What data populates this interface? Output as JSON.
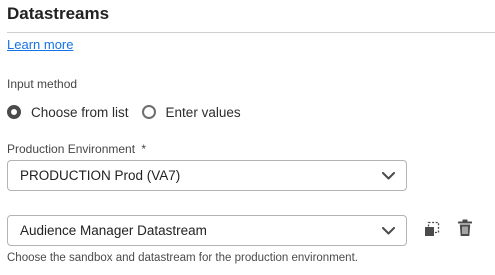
{
  "section": {
    "title": "Datastreams",
    "learn_more": "Learn more"
  },
  "input_method": {
    "label": "Input method",
    "options": [
      {
        "label": "Choose from list",
        "selected": true
      },
      {
        "label": "Enter values",
        "selected": false
      }
    ]
  },
  "production": {
    "label": "Production Environment",
    "required_marker": "*",
    "value": "PRODUCTION Prod (VA7)"
  },
  "datastream": {
    "value": "Audience Manager Datastream",
    "help_text": "Choose the sandbox and datastream for the production environment."
  },
  "icons": {
    "dropdown": "chevron-down-icon",
    "copy": "copy-icon",
    "delete": "trash-icon"
  }
}
